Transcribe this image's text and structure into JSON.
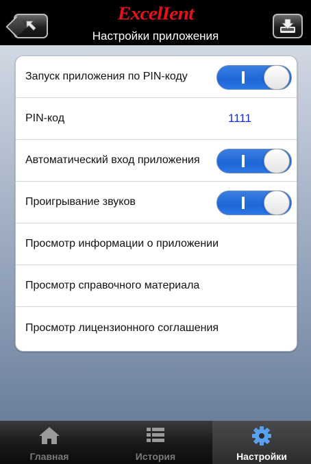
{
  "header": {
    "brand": "ExcelIent",
    "title": "Настройки приложения",
    "back_icon": "back-arrow-icon",
    "download_icon": "download-icon"
  },
  "settings": {
    "rows": [
      {
        "label": "Запуск приложения по PIN-коду",
        "type": "toggle",
        "on": true,
        "toggle_text": "I"
      },
      {
        "label": "PIN-код",
        "type": "value",
        "value": "1111"
      },
      {
        "label": "Автоматический вход приложения",
        "type": "toggle",
        "on": true,
        "toggle_text": "I"
      },
      {
        "label": "Проигрывание звуков",
        "type": "toggle",
        "on": true,
        "toggle_text": "I"
      },
      {
        "label": "Просмотр  информации о приложении",
        "type": "link"
      },
      {
        "label": "Просмотр  справочного материала",
        "type": "link"
      },
      {
        "label": "Просмотр  лицензионного соглашения",
        "type": "link"
      }
    ]
  },
  "tabbar": {
    "tabs": [
      {
        "label": "Главная",
        "icon": "home-icon",
        "active": false
      },
      {
        "label": "История",
        "icon": "list-icon",
        "active": false
      },
      {
        "label": "Настройки",
        "icon": "gear-icon",
        "active": true
      }
    ]
  },
  "colors": {
    "brand_red": "#e0121b",
    "toggle_blue": "#2b76e6",
    "pin_blue": "#1a2bd6"
  }
}
